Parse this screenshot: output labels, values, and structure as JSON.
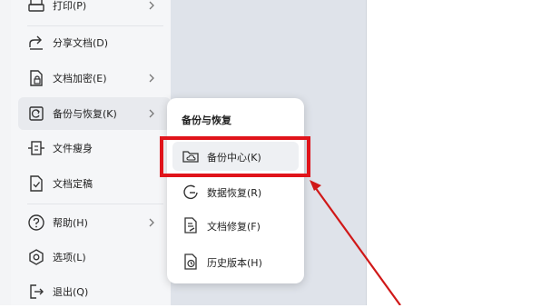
{
  "menu": {
    "items": [
      {
        "label": "打印(P)",
        "icon": "printer-icon",
        "has_submenu": true
      },
      {
        "label": "分享文档(D)",
        "icon": "share-icon",
        "has_submenu": false
      },
      {
        "label": "文档加密(E)",
        "icon": "lock-document-icon",
        "has_submenu": true
      },
      {
        "label": "备份与恢复(K)",
        "icon": "backup-icon",
        "has_submenu": true
      },
      {
        "label": "文件瘦身",
        "icon": "compress-icon",
        "has_submenu": false
      },
      {
        "label": "文档定稿",
        "icon": "finalize-document-icon",
        "has_submenu": false
      },
      {
        "label": "帮助(H)",
        "icon": "help-icon",
        "has_submenu": true
      },
      {
        "label": "选项(L)",
        "icon": "settings-icon",
        "has_submenu": false
      },
      {
        "label": "退出(Q)",
        "icon": "exit-icon",
        "has_submenu": false
      }
    ]
  },
  "submenu": {
    "title": "备份与恢复",
    "items": [
      {
        "label": "备份中心(K)",
        "icon": "cloud-folder-icon"
      },
      {
        "label": "数据恢复(R)",
        "icon": "restore-icon"
      },
      {
        "label": "文档修复(F)",
        "icon": "repair-document-icon"
      },
      {
        "label": "历史版本(H)",
        "icon": "history-icon"
      }
    ]
  },
  "colors": {
    "highlight_box": "#e0141a",
    "annotation_arrow": "#d01818"
  }
}
